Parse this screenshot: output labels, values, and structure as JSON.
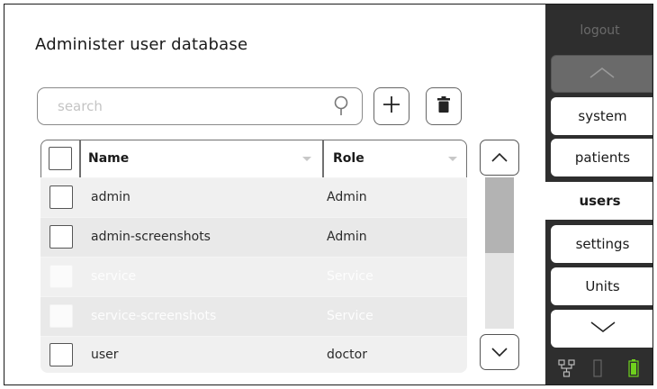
{
  "page": {
    "title": "Administer user database"
  },
  "search": {
    "placeholder": "search"
  },
  "table": {
    "columns": [
      "Name",
      "Role"
    ],
    "rows": [
      {
        "name": "admin",
        "role": "Admin",
        "enabled": true
      },
      {
        "name": "admin-screenshots",
        "role": "Admin",
        "enabled": true
      },
      {
        "name": "service",
        "role": "Service",
        "enabled": false
      },
      {
        "name": "service-screenshots",
        "role": "Service",
        "enabled": false
      },
      {
        "name": "user",
        "role": "doctor",
        "enabled": true
      }
    ],
    "scroll_position": 0.0,
    "scroll_visible_fraction": 0.5
  },
  "sidebar": {
    "logout": "logout",
    "items": [
      "system",
      "patients",
      "users",
      "settings",
      "Units"
    ],
    "active": "users"
  },
  "icons": [
    "search-icon",
    "plus-icon",
    "trash-icon",
    "chevron-up-icon",
    "chevron-down-icon",
    "network-icon",
    "device-icon",
    "battery-icon"
  ],
  "colors": {
    "sidebar": "#2e2e2e",
    "battery": "#6fd11d"
  }
}
